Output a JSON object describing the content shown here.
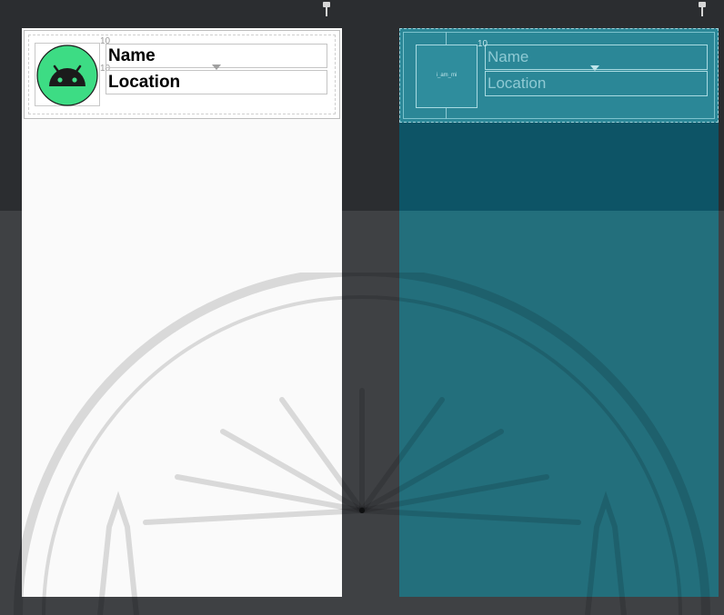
{
  "design_view": {
    "name_label": "Name",
    "location_label": "Location",
    "margin_label": "10",
    "avatar_icon": "android-icon"
  },
  "blueprint_view": {
    "name_label": "Name",
    "location_label": "Location",
    "margin_label": "10",
    "avatar_placeholder": "i_am_mi"
  },
  "colors": {
    "editor_bg": "#2b2d30",
    "design_bg": "#fafafa",
    "blueprint_dark": "#0d5466",
    "blueprint_light": "#236f7c",
    "android_green": "#3ddc84"
  }
}
